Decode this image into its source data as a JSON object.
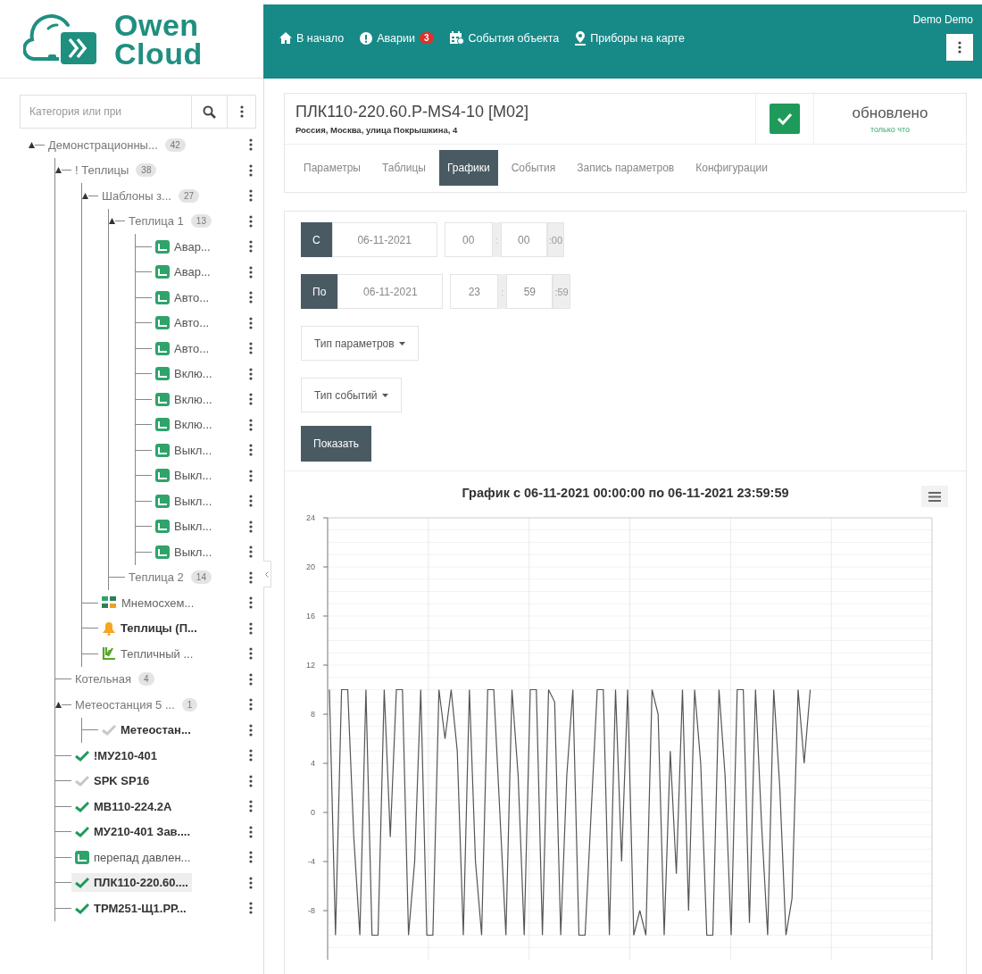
{
  "header": {
    "logo": {
      "line1": "Owen",
      "line2": "Cloud"
    },
    "nav": [
      {
        "kind": "home",
        "label": "В начало"
      },
      {
        "kind": "alarm",
        "label": "Аварии",
        "badge": "3"
      },
      {
        "kind": "events",
        "label": "События объекта"
      },
      {
        "kind": "map",
        "label": "Приборы на карте"
      }
    ],
    "user": "Demo Demo"
  },
  "sidebar": {
    "search": {
      "placeholder": "Категория или при"
    },
    "tree": [
      {
        "label": "Демонстрационны...",
        "kind": "folder",
        "count": "42",
        "expanded": true,
        "selected": false,
        "children": [
          {
            "label": "! Теплицы",
            "kind": "folder",
            "count": "38",
            "expanded": true,
            "selected": false,
            "children": [
              {
                "label": "Шаблоны з...",
                "kind": "folder",
                "count": "27",
                "expanded": true,
                "selected": false,
                "children": [
                  {
                    "label": "Теплица 1",
                    "kind": "folder",
                    "count": "13",
                    "expanded": true,
                    "selected": false,
                    "children": [
                      {
                        "label": "Авар...",
                        "kind": "template",
                        "selected": false
                      },
                      {
                        "label": "Авар...",
                        "kind": "template",
                        "selected": false
                      },
                      {
                        "label": "Авто...",
                        "kind": "template",
                        "selected": false
                      },
                      {
                        "label": "Авто...",
                        "kind": "template",
                        "selected": false
                      },
                      {
                        "label": "Авто...",
                        "kind": "template",
                        "selected": false
                      },
                      {
                        "label": "Вклю...",
                        "kind": "template",
                        "selected": false
                      },
                      {
                        "label": "Вклю...",
                        "kind": "template",
                        "selected": false
                      },
                      {
                        "label": "Вклю...",
                        "kind": "template",
                        "selected": false
                      },
                      {
                        "label": "Выкл...",
                        "kind": "template",
                        "selected": false
                      },
                      {
                        "label": "Выкл...",
                        "kind": "template",
                        "selected": false
                      },
                      {
                        "label": "Выкл...",
                        "kind": "template",
                        "selected": false
                      },
                      {
                        "label": "Выкл...",
                        "kind": "template",
                        "selected": false
                      },
                      {
                        "label": "Выкл...",
                        "kind": "template",
                        "selected": false
                      }
                    ]
                  },
                  {
                    "label": "Теплица 2",
                    "kind": "folder",
                    "count": "14",
                    "expanded": false,
                    "selected": false
                  }
                ]
              },
              {
                "label": "Мнемосхем...",
                "kind": "mnemo",
                "selected": false
              },
              {
                "label": "Теплицы (П...",
                "kind": "alarm",
                "selected": false
              },
              {
                "label": "Тепличный ...",
                "kind": "scheme",
                "selected": false
              }
            ]
          },
          {
            "label": "Котельная",
            "kind": "folder",
            "count": "4",
            "expanded": false,
            "selected": false
          },
          {
            "label": "Метеостанция 5 ...",
            "kind": "folder",
            "count": "1",
            "expanded": true,
            "selected": false,
            "children": [
              {
                "label": "Метеостан...",
                "kind": "device",
                "online": false,
                "selected": false
              }
            ]
          },
          {
            "label": "!МУ210-401",
            "kind": "device",
            "online": true,
            "selected": false
          },
          {
            "label": "SPK SP16",
            "kind": "device",
            "online": false,
            "selected": false
          },
          {
            "label": "МВ110-224.2А",
            "kind": "device",
            "online": true,
            "selected": false
          },
          {
            "label": "МУ210-401 Зав....",
            "kind": "device",
            "online": true,
            "selected": false
          },
          {
            "label": "перепад давлен...",
            "kind": "template",
            "selected": false
          },
          {
            "label": "ПЛК110-220.60....",
            "kind": "device",
            "online": true,
            "selected": true
          },
          {
            "label": "ТРМ251-Щ1.РР...",
            "kind": "device",
            "online": true,
            "selected": false
          }
        ]
      }
    ]
  },
  "device": {
    "title": "ПЛК110-220.60.Р-MS4-10 [M02]",
    "address": "Россия, Москва, улица Покрышкина, 4",
    "online": true,
    "status": "обновлено",
    "status_time": "только что",
    "tabs": [
      {
        "label": "Параметры",
        "selected": false
      },
      {
        "label": "Таблицы",
        "selected": false
      },
      {
        "label": "Графики",
        "selected": true
      },
      {
        "label": "События",
        "selected": false
      },
      {
        "label": "Запись параметров",
        "selected": false
      },
      {
        "label": "Конфигурации",
        "selected": false
      }
    ]
  },
  "filter": {
    "ranges": [
      {
        "label": "С",
        "date": "06-11-2021",
        "hours": "00",
        "separator": ":",
        "minutes": "00",
        "seconds": ":00"
      },
      {
        "label": "По",
        "date": "06-11-2021",
        "hours": "23",
        "separator": ":",
        "minutes": "59",
        "seconds": ":59"
      }
    ],
    "dropdowns": [
      "Тип параметров",
      "Тип событий"
    ],
    "button": "Показать"
  },
  "chart": {
    "chart_data": {
      "type": "line",
      "title": "График с 06-11-2021 00:00:00 по 06-11-2021 23:59:59",
      "ylim": [
        -12,
        24
      ],
      "grid": true,
      "yticks": [
        -8,
        -4,
        0,
        4,
        8,
        12,
        16,
        20,
        24
      ],
      "series": [
        {
          "color": "#555555",
          "values": [
            10,
            -10,
            10,
            10,
            -2,
            -10,
            10,
            -10,
            -10,
            10,
            -2,
            10,
            10,
            -10,
            -4,
            10,
            -10,
            -10,
            10,
            6,
            10,
            5,
            -10,
            10,
            -4,
            -10,
            10,
            10,
            0,
            -10,
            10,
            3,
            -10,
            10,
            10,
            -10,
            10,
            9,
            -10,
            3,
            10,
            -10,
            -10,
            0,
            10,
            10,
            -10,
            10,
            -4,
            10,
            -10,
            -8,
            -10,
            10,
            8,
            -10,
            5,
            -5,
            10,
            -8,
            10,
            4,
            -10,
            -10,
            10,
            3,
            -10,
            10,
            10,
            -9,
            10,
            -1,
            -10,
            10,
            2,
            -10,
            -7,
            10,
            4,
            10,
            null,
            null,
            null,
            null,
            null,
            null,
            null,
            null,
            null,
            null,
            null,
            null,
            null,
            null,
            null,
            null,
            null,
            null,
            null,
            null
          ]
        }
      ]
    }
  }
}
